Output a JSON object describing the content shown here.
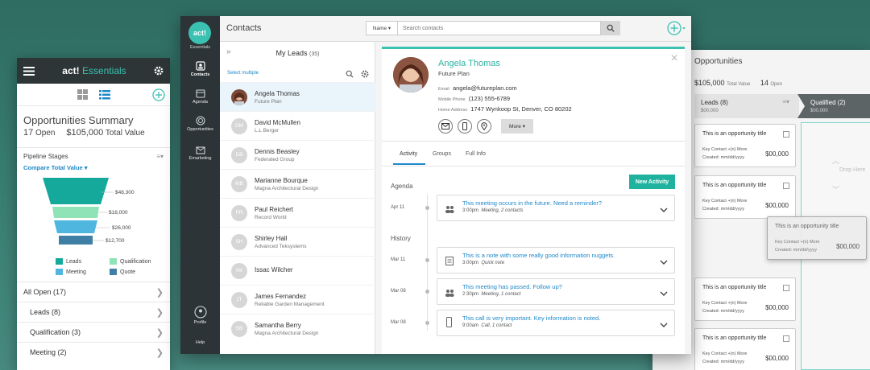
{
  "mobile": {
    "brand_prefix": "act!",
    "brand_suffix": "Essentials",
    "title": "Opportunities Summary",
    "open_count": "17",
    "open_label": "Open",
    "total_value": "$105,000",
    "total_value_label": "Total Value",
    "pipeline_label": "Pipeline Stages",
    "compare_link": "Compare Total Value",
    "funnel": [
      {
        "stage": "Leads",
        "value": "$48,300",
        "color": "#14a99a"
      },
      {
        "stage": "Qualification",
        "value": "$18,000",
        "color": "#8fe3b6"
      },
      {
        "stage": "Meeting",
        "value": "$26,000",
        "color": "#4fb6df"
      },
      {
        "stage": "Quote",
        "value": "$12,700",
        "color": "#3f7fa6"
      }
    ],
    "list": [
      {
        "label": "All Open (17)"
      },
      {
        "label": "Leads (8)"
      },
      {
        "label": "Qualification (3)"
      },
      {
        "label": "Meeting (2)"
      }
    ]
  },
  "desktop": {
    "nav": {
      "logo": "act!",
      "logo_sub": "Essentials",
      "items": [
        "Contacts",
        "Agenda",
        "Opportunities",
        "Emarketing"
      ],
      "profile": "Profile",
      "help": "Help"
    },
    "page_title": "Contacts",
    "search": {
      "scope": "Name",
      "placeholder": "Search contacts"
    },
    "leads": {
      "title": "My Leads",
      "count": "(35)",
      "select_multiple": "Select multiple",
      "items": [
        {
          "initials": "",
          "name": "Angela Thomas",
          "company": "Future Plan"
        },
        {
          "initials": "DM",
          "name": "David McMullen",
          "company": "L.L Berger"
        },
        {
          "initials": "DB",
          "name": "Dennis Beasley",
          "company": "Federated Group"
        },
        {
          "initials": "MB",
          "name": "Marianne Bourque",
          "company": "Magna Architectural Design"
        },
        {
          "initials": "PR",
          "name": "Paul Reichert",
          "company": "Record World"
        },
        {
          "initials": "SH",
          "name": "Shirley Hall",
          "company": "Advanced Teksystems"
        },
        {
          "initials": "IW",
          "name": "Issac Wilcher",
          "company": ""
        },
        {
          "initials": "JT",
          "name": "James Fernandez",
          "company": "Reliable Garden Management"
        },
        {
          "initials": "SB",
          "name": "Samantha Berry",
          "company": "Magna Architectural Design"
        }
      ]
    },
    "contact": {
      "name": "Angela Thomas",
      "company": "Future Plan",
      "email_label": "Email",
      "email": "angela@futureplan.com",
      "phone_label": "Mobile Phone",
      "phone": "(123) 555-6789",
      "address_label": "Home Address",
      "address": "1747 Wynkoop St, Denver, CO 80202",
      "more": "More",
      "tabs": [
        "Activity",
        "Groups",
        "Full Info"
      ],
      "agenda_label": "Agenda",
      "new_activity": "New Activity",
      "history_label": "History",
      "agenda": [
        {
          "date": "Apr 11",
          "title": "This meeting occurs in the future. Need a reminder?",
          "time": "3:00pm",
          "detail": "Meeting, 2 contacts"
        }
      ],
      "history": [
        {
          "date": "Mar 11",
          "title": "This is a note with some really good information nuggets.",
          "time": "3:00pm",
          "detail": "Quick note"
        },
        {
          "date": "Mar 08",
          "title": "This meeting has passed. Follow up?",
          "time": "2:30pm",
          "detail": "Meeting, 1 contact"
        },
        {
          "date": "Mar 08",
          "title": "This call is very important. Key information is noted.",
          "time": "9:00am",
          "detail": "Call, 1 contact"
        }
      ]
    }
  },
  "kanban": {
    "title": "Opportunities",
    "total_value": "$105,000",
    "total_value_label": "Total Value",
    "open_count": "14",
    "open_label": "Open",
    "columns": [
      {
        "name": "Leads (8)",
        "value": "$00,000"
      },
      {
        "name": "Qualified (2)",
        "value": "$00,000"
      }
    ],
    "drop_here": "Drop Here",
    "card": {
      "title": "This is an opportunity title",
      "key_contact": "Key Contact +(n) More",
      "created": "Created: mm/dd/yyyy",
      "amount": "$00,000"
    },
    "dragged": {
      "title": "This is an opportunity title",
      "key_contact": "Key Contact +(n) More",
      "created": "Created: mm/dd/yyyy",
      "amount": "$00,000"
    }
  },
  "colors": {
    "accent": "#3bc1b2",
    "link": "#1e88c9",
    "nav": "#2c3437"
  }
}
